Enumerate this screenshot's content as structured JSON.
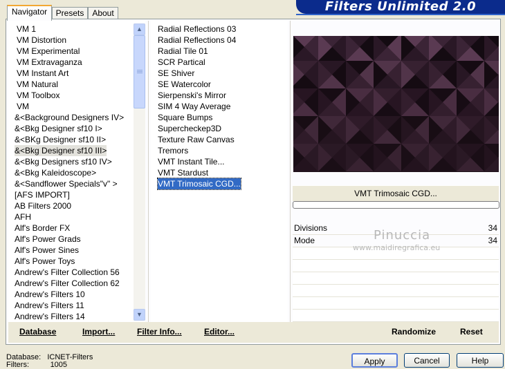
{
  "banner_title": "Filters Unlimited 2.0",
  "tabs": [
    "Navigator",
    "Presets",
    "About"
  ],
  "categories": [
    "VM 1",
    "VM Distortion",
    "VM Experimental",
    "VM Extravaganza",
    "VM Instant Art",
    "VM Natural",
    "VM Toolbox",
    "VM",
    "&<Background Designers IV>",
    "&<Bkg Designer sf10 I>",
    "&<BKg Designer sf10 II>",
    "&<Bkg Designer sf10 III>",
    "&<Bkg Designers sf10 IV>",
    "&<Bkg Kaleidoscope>",
    "&<Sandflower Specials\"v\" >",
    "[AFS IMPORT]",
    "AB Filters 2000",
    "AFH",
    "Alf's Border FX",
    "Alf's Power Grads",
    "Alf's Power Sines",
    "Alf's Power Toys",
    "Andrew's Filter Collection 56",
    "Andrew's Filter Collection 62",
    "Andrew's Filters 10",
    "Andrew's Filters 11",
    "Andrew's Filters 14"
  ],
  "selected_category_index": 11,
  "filters": [
    "Radial Reflections 03",
    "Radial Reflections 04",
    "Radial Tile 01",
    "SCR  Partical",
    "SE Shiver",
    "SE Watercolor",
    "Sierpenski's Mirror",
    "SIM 4 Way Average",
    "Square Bumps",
    "Supercheckер3D",
    "Texture Raw Canvas",
    "Tremors",
    "VMT Instant Tile...",
    "VMT Stardust",
    "VMT Trimosaic CGD..."
  ],
  "selected_filter_index": 14,
  "filter_title": "VMT Trimosaic CGD...",
  "params": [
    {
      "label": "Divisions",
      "value": "34"
    },
    {
      "label": "Mode",
      "value": "34"
    }
  ],
  "watermark": {
    "name": "Pinuccia",
    "url": "www.maidiregrafica.eu"
  },
  "actions": {
    "database": "Database",
    "import": "Import...",
    "filter_info": "Filter Info...",
    "editor": "Editor...",
    "randomize": "Randomize",
    "reset": "Reset"
  },
  "buttons": {
    "apply": "Apply",
    "cancel": "Cancel",
    "help": "Help"
  },
  "status": {
    "database_label": "Database:",
    "database_value": "ICNET-Filters",
    "filters_label": "Filters:",
    "filters_value": "1005"
  },
  "colors": {
    "banner": "#0b2b8c",
    "selection": "#316ac5",
    "preview_dark": "#1f1119",
    "preview_light": "#4a2f44"
  }
}
